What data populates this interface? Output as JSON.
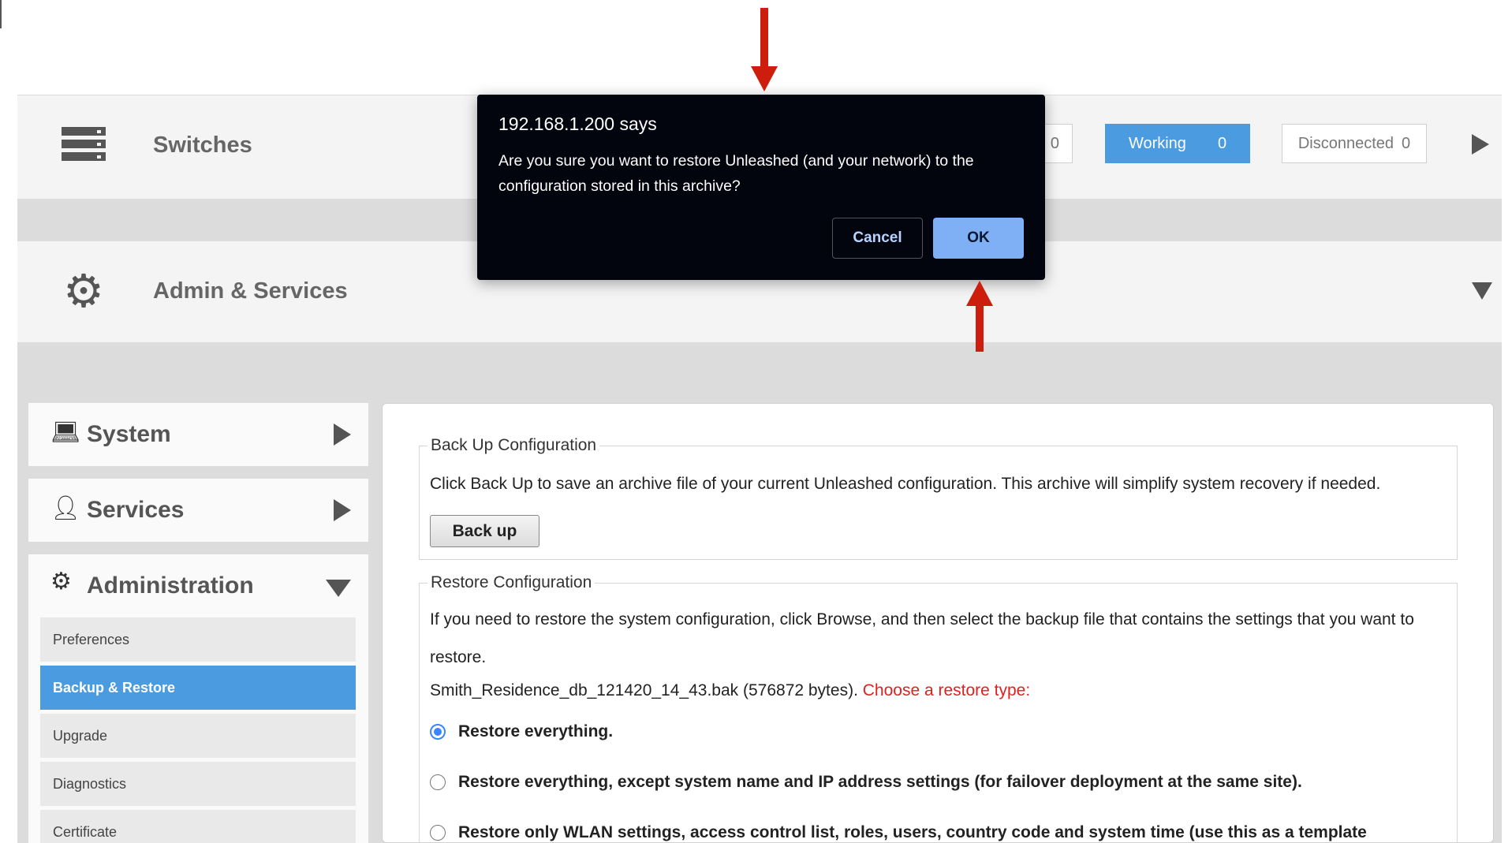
{
  "switches": {
    "title": "Switches",
    "icon": "server-rack-icon",
    "partial_counter_value": "0",
    "working_label": "Working",
    "working_count": "0",
    "disconnected_label": "Disconnected",
    "disconnected_count": "0"
  },
  "admin_services": {
    "title": "Admin & Services",
    "icon": "gear-icon"
  },
  "sidebar": {
    "system_label": "System",
    "services_label": "Services",
    "administration_label": "Administration",
    "subitems": [
      {
        "label": "Preferences",
        "active": false
      },
      {
        "label": "Backup & Restore",
        "active": true
      },
      {
        "label": "Upgrade",
        "active": false
      },
      {
        "label": "Diagnostics",
        "active": false
      },
      {
        "label": "Certificate",
        "active": false
      }
    ]
  },
  "backup": {
    "legend": "Back Up Configuration",
    "description": "Click Back Up to save an archive file of your current Unleashed configuration. This archive will simplify system recovery if needed.",
    "button_label": "Back up"
  },
  "restore": {
    "legend": "Restore Configuration",
    "description": "If you need to restore the system configuration, click Browse, and then select the backup file that contains the settings that you want to restore.",
    "file_info": "Smith_Residence_db_121420_14_43.bak (576872 bytes).",
    "choose_prompt": "Choose a restore type:",
    "options": [
      {
        "label": "Restore everything.",
        "checked": true
      },
      {
        "label": "Restore everything, except system name and IP address settings (for failover deployment at the same site).",
        "checked": false
      },
      {
        "label": "Restore only WLAN settings, access control list, roles, users, country code and system time (use this as a template",
        "checked": false
      }
    ]
  },
  "dialog": {
    "title": "192.168.1.200 says",
    "message": "Are you sure you want to restore Unleashed (and your network) to the configuration stored in this archive?",
    "cancel_label": "Cancel",
    "ok_label": "OK"
  },
  "colors": {
    "accent_blue": "#4a9be0",
    "warning_red": "#e02020",
    "annotation_arrow": "#cc1d0d",
    "dialog_bg": "#02040e"
  }
}
